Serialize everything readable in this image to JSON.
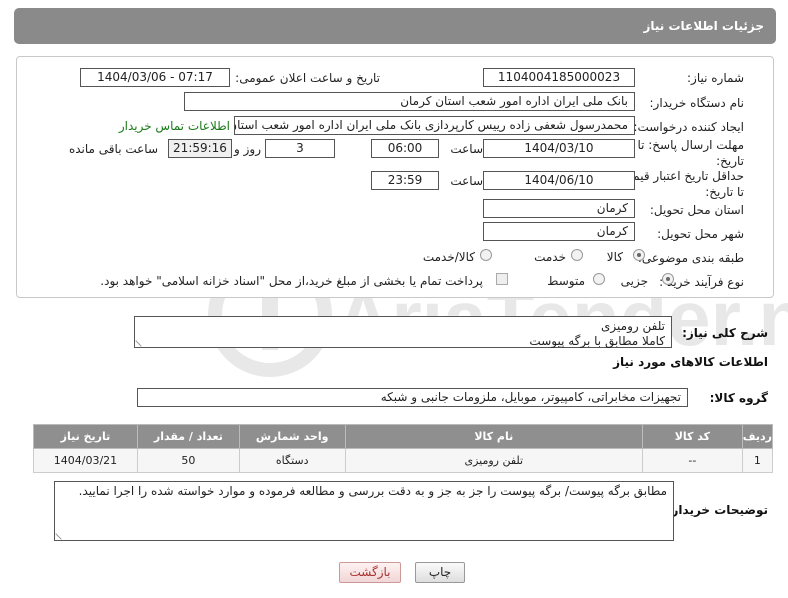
{
  "header": {
    "title": "جزئیات اطلاعات نیاز"
  },
  "form": {
    "need_number_label": "شماره نیاز:",
    "need_number": "1104004185000023",
    "announce_label": "تاریخ و ساعت اعلان عمومی:",
    "announce_value": "1404/03/06 - 07:17",
    "buyer_label": "نام دستگاه خریدار:",
    "buyer_value": "بانک ملی ایران اداره امور شعب استان کرمان",
    "creator_label": "ایجاد کننده درخواست:",
    "creator_value": "محمدرسول شعفی زاده رییس کارپردازی بانک ملی ایران اداره امور شعب استان",
    "contact_link": "اطلاعات تماس خریدار",
    "deadline_label": "مهلت ارسال پاسخ: تا تاریخ:",
    "deadline_date": "1404/03/10",
    "time_label": "ساعت",
    "deadline_time": "06:00",
    "days_value": "3",
    "days_label": "روز و",
    "remaining_time": "21:59:16",
    "remaining_label": "ساعت باقی مانده",
    "validity_label": "حداقل تاریخ اعتبار قیمت: تا تاریخ:",
    "validity_date": "1404/06/10",
    "validity_time_label": "ساعت",
    "validity_time": "23:59",
    "province_label": "استان محل تحویل:",
    "province_value": "کرمان",
    "city_label": "شهر محل تحویل:",
    "city_value": "کرمان",
    "category_label": "طبقه بندی موضوعی:",
    "category_options": [
      "کالا",
      "خدمت",
      "کالا/خدمت"
    ],
    "process_label": "نوع فرآیند خرید :",
    "process_options": [
      "جزیی",
      "متوسط"
    ],
    "payment_note": "پرداخت تمام یا بخشی از مبلغ خرید،از محل \"اسناد خزانه اسلامی\" خواهد بود."
  },
  "description": {
    "label": "شرح کلی نیاز:",
    "text_line1": "تلفن رومیزی",
    "text_line2": "کاملا مطابق با برگه پیوست"
  },
  "goods_section": {
    "title": "اطلاعات کالاهای مورد نیاز",
    "group_label": "گروه کالا:",
    "group_value": "تجهیزات مخابراتی، کامپیوتر، موبایل، ملزومات جانبی و شبکه",
    "columns": [
      "ردیف",
      "کد کالا",
      "نام کالا",
      "واحد شمارش",
      "تعداد / مقدار",
      "تاریخ نیاز"
    ],
    "rows": [
      {
        "row": "1",
        "code": "--",
        "name": "تلفن رومیزی",
        "unit": "دستگاه",
        "qty": "50",
        "date": "1404/03/21"
      }
    ]
  },
  "buyer_notes": {
    "label": "توضیحات خریدار:",
    "text": "مطابق برگه پیوست/ برگه پیوست را جز به جز و به دقت بررسی و مطالعه فرموده و موارد خواسته شده را اجرا نمایید."
  },
  "buttons": {
    "print": "چاپ",
    "back": "بازگشت"
  },
  "watermark": {
    "text": "AriaTender.neT"
  }
}
